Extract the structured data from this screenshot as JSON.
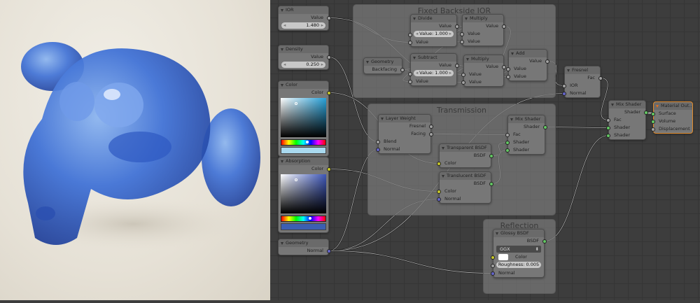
{
  "colors": {
    "value": "#a1a1a1",
    "color": "#c7c729",
    "vector": "#6363c7",
    "shader": "#63c763",
    "output_border": "#e08a2a"
  },
  "frames": [
    {
      "id": "f_ior",
      "label": "Fixed Backside IOR"
    },
    {
      "id": "f_trans",
      "label": "Transmission"
    },
    {
      "id": "f_refl",
      "label": "Reflection"
    }
  ],
  "nodes": [
    {
      "id": "ior",
      "title": "IOR",
      "rows": [
        {
          "t": "out",
          "label": "Value",
          "s": "value"
        },
        {
          "t": "field",
          "label": "1.480",
          "num": true
        }
      ]
    },
    {
      "id": "density",
      "title": "Density",
      "rows": [
        {
          "t": "out",
          "label": "Value",
          "s": "value"
        },
        {
          "t": "field",
          "label": "0.250",
          "num": true
        }
      ]
    },
    {
      "id": "color",
      "title": "Color",
      "rows": [
        {
          "t": "out",
          "label": "Color",
          "s": "color"
        },
        {
          "t": "picker",
          "sv": "#27a0d8",
          "swatch": "#a9d9ef",
          "hue": 0.55
        }
      ]
    },
    {
      "id": "absorption",
      "title": "Absorption",
      "rows": [
        {
          "t": "out",
          "label": "Color",
          "s": "color"
        },
        {
          "t": "picker",
          "sv": "#3d56b8",
          "swatch": "#3c5fb1",
          "hue": 0.62
        }
      ]
    },
    {
      "id": "geometry",
      "title": "Geometry",
      "rows": [
        {
          "t": "out",
          "label": "Normal",
          "s": "vector"
        }
      ]
    },
    {
      "id": "divide",
      "title": "Divide",
      "rows": [
        {
          "t": "out",
          "label": "Value",
          "s": "value"
        },
        {
          "t": "field",
          "label": "Value: 1.000",
          "in": "value"
        },
        {
          "t": "in",
          "label": "Value",
          "s": "value"
        }
      ]
    },
    {
      "id": "multiply1",
      "title": "Multiply",
      "rows": [
        {
          "t": "out",
          "label": "Value",
          "s": "value"
        },
        {
          "t": "in",
          "label": "Value",
          "s": "value"
        },
        {
          "t": "in",
          "label": "Value",
          "s": "value"
        }
      ]
    },
    {
      "id": "geometry2",
      "title": "Geometry",
      "rows": [
        {
          "t": "out",
          "label": "Backfacing",
          "s": "value"
        }
      ]
    },
    {
      "id": "subtract",
      "title": "Subtract",
      "rows": [
        {
          "t": "out",
          "label": "Value",
          "s": "value"
        },
        {
          "t": "field",
          "label": "Value: 1.000",
          "in": "value"
        },
        {
          "t": "in",
          "label": "Value",
          "s": "value"
        }
      ]
    },
    {
      "id": "multiply2",
      "title": "Multiply",
      "rows": [
        {
          "t": "out",
          "label": "Value",
          "s": "value"
        },
        {
          "t": "in",
          "label": "Value",
          "s": "value"
        },
        {
          "t": "in",
          "label": "Value",
          "s": "value"
        }
      ]
    },
    {
      "id": "add",
      "title": "Add",
      "rows": [
        {
          "t": "out",
          "label": "Value",
          "s": "value"
        },
        {
          "t": "in",
          "label": "Value",
          "s": "value"
        },
        {
          "t": "in",
          "label": "Value",
          "s": "value"
        }
      ]
    },
    {
      "id": "fresnel",
      "title": "Fresnel",
      "rows": [
        {
          "t": "out",
          "label": "Fac",
          "s": "value"
        },
        {
          "t": "in",
          "label": "IOR",
          "s": "value"
        },
        {
          "t": "in",
          "label": "Normal",
          "s": "vector"
        }
      ]
    },
    {
      "id": "layerweight",
      "title": "Layer Weight",
      "rows": [
        {
          "t": "out",
          "label": "Fresnel",
          "s": "value"
        },
        {
          "t": "out",
          "label": "Facing",
          "s": "value"
        },
        {
          "t": "in",
          "label": "Blend",
          "s": "value"
        },
        {
          "t": "in",
          "label": "Normal",
          "s": "vector"
        }
      ]
    },
    {
      "id": "transparent",
      "title": "Transparent BSDF",
      "rows": [
        {
          "t": "out",
          "label": "BSDF",
          "s": "shader"
        },
        {
          "t": "in",
          "label": "Color",
          "s": "color"
        }
      ]
    },
    {
      "id": "translucent",
      "title": "Translucent BSDF",
      "rows": [
        {
          "t": "out",
          "label": "BSDF",
          "s": "shader"
        },
        {
          "t": "in",
          "label": "Color",
          "s": "color"
        },
        {
          "t": "in",
          "label": "Normal",
          "s": "vector"
        }
      ]
    },
    {
      "id": "mix1",
      "title": "Mix Shader",
      "rows": [
        {
          "t": "out",
          "label": "Shader",
          "s": "shader"
        },
        {
          "t": "in",
          "label": "Fac",
          "s": "value"
        },
        {
          "t": "in",
          "label": "Shader",
          "s": "shader"
        },
        {
          "t": "in",
          "label": "Shader",
          "s": "shader"
        }
      ]
    },
    {
      "id": "glossy",
      "title": "Glossy BSDF",
      "rows": [
        {
          "t": "out",
          "label": "BSDF",
          "s": "shader"
        },
        {
          "t": "dropdown",
          "label": "GGX"
        },
        {
          "t": "colorin",
          "label": "Color",
          "s": "color",
          "swatch": "#ffffff"
        },
        {
          "t": "field",
          "label": "Roughness: 0.005",
          "in": "value",
          "plain": true
        },
        {
          "t": "in",
          "label": "Normal",
          "s": "vector"
        }
      ]
    },
    {
      "id": "mix2",
      "title": "Mix Shader",
      "rows": [
        {
          "t": "out",
          "label": "Shader",
          "s": "shader"
        },
        {
          "t": "in",
          "label": "Fac",
          "s": "value"
        },
        {
          "t": "in",
          "label": "Shader",
          "s": "shader"
        },
        {
          "t": "in",
          "label": "Shader",
          "s": "shader"
        }
      ]
    },
    {
      "id": "output",
      "title": "Material Out...",
      "output": true,
      "rows": [
        {
          "t": "in",
          "label": "Surface",
          "s": "shader"
        },
        {
          "t": "in",
          "label": "Volume",
          "s": "shader"
        },
        {
          "t": "in",
          "label": "Displacement",
          "s": "value"
        }
      ]
    }
  ],
  "links": [
    [
      "ior",
      0,
      "divide",
      2
    ],
    [
      "ior",
      0,
      "multiply2",
      2
    ],
    [
      "geometry2",
      0,
      "subtract",
      2
    ],
    [
      "geometry2",
      0,
      "multiply1",
      2
    ],
    [
      "divide",
      0,
      "multiply1",
      1
    ],
    [
      "subtract",
      0,
      "multiply2",
      1
    ],
    [
      "multiply1",
      0,
      "add",
      1
    ],
    [
      "multiply2",
      0,
      "add",
      2
    ],
    [
      "add",
      0,
      "fresnel",
      1
    ],
    [
      "fresnel",
      0,
      "mix2",
      1
    ],
    [
      "density",
      0,
      "layerweight",
      2
    ],
    [
      "color",
      0,
      "transparent",
      1
    ],
    [
      "absorption",
      0,
      "translucent",
      1
    ],
    [
      "geometry",
      0,
      "layerweight",
      3
    ],
    [
      "geometry",
      0,
      "translucent",
      2
    ],
    [
      "geometry",
      0,
      "fresnel",
      2
    ],
    [
      "geometry",
      0,
      "glossy",
      4
    ],
    [
      "layerweight",
      1,
      "mix1",
      1
    ],
    [
      "transparent",
      0,
      "mix1",
      2
    ],
    [
      "translucent",
      0,
      "mix1",
      3
    ],
    [
      "mix1",
      0,
      "mix2",
      2
    ],
    [
      "glossy",
      0,
      "mix2",
      3
    ],
    [
      "mix2",
      0,
      "output",
      0
    ]
  ]
}
